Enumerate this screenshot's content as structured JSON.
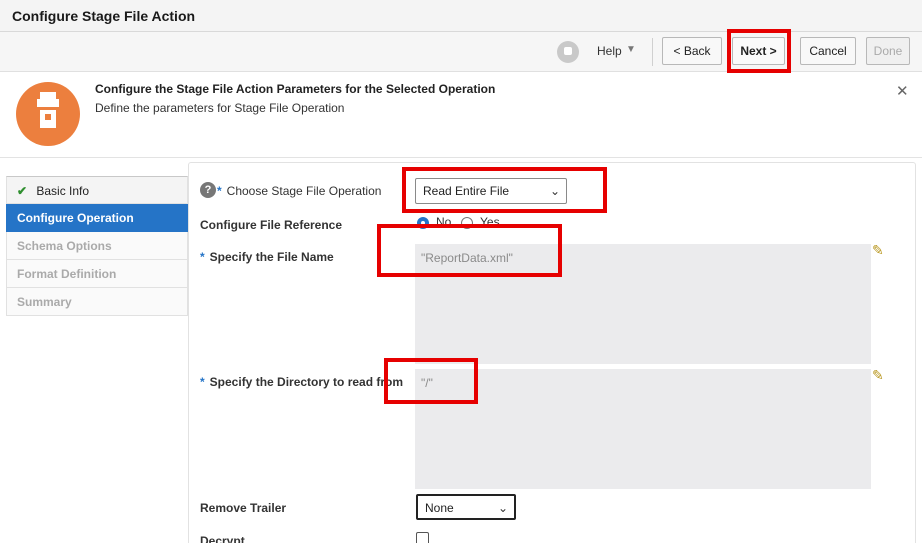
{
  "window": {
    "title": "Configure Stage File Action"
  },
  "toolbar": {
    "help_label": "Help",
    "back_label": "< Back",
    "next_label": "Next >",
    "cancel_label": "Cancel",
    "done_label": "Done"
  },
  "header": {
    "title": "Configure the Stage File Action Parameters for the Selected Operation",
    "subtitle": "Define the parameters for Stage File Operation",
    "close_glyph": "✕"
  },
  "nav": {
    "items": [
      {
        "label": "Basic Info",
        "state": "completed"
      },
      {
        "label": "Configure Operation",
        "state": "active"
      },
      {
        "label": "Schema Options",
        "state": "disabled"
      },
      {
        "label": "Format Definition",
        "state": "disabled"
      },
      {
        "label": "Summary",
        "state": "disabled"
      }
    ]
  },
  "form": {
    "operation": {
      "label": "Choose Stage File Operation",
      "value": "Read Entire File"
    },
    "file_reference": {
      "label": "Configure File Reference",
      "options": [
        "No",
        "Yes"
      ],
      "selected": "No"
    },
    "file_name": {
      "label": "Specify the File Name",
      "value": "\"ReportData.xml\""
    },
    "directory": {
      "label": "Specify the Directory to read from",
      "value": "\"/\""
    },
    "remove_trailer": {
      "label": "Remove Trailer",
      "value": "None"
    },
    "decrypt": {
      "label": "Decrypt",
      "checked": false
    }
  },
  "icons": {
    "required_marker": "*",
    "help_question": "?",
    "chevron": "⌄",
    "pencil": "✎",
    "check": "✔",
    "caret": "▼"
  },
  "colors": {
    "accent": "#2574c7",
    "highlight": "#e60000",
    "header_icon": "#ec7f3e"
  }
}
